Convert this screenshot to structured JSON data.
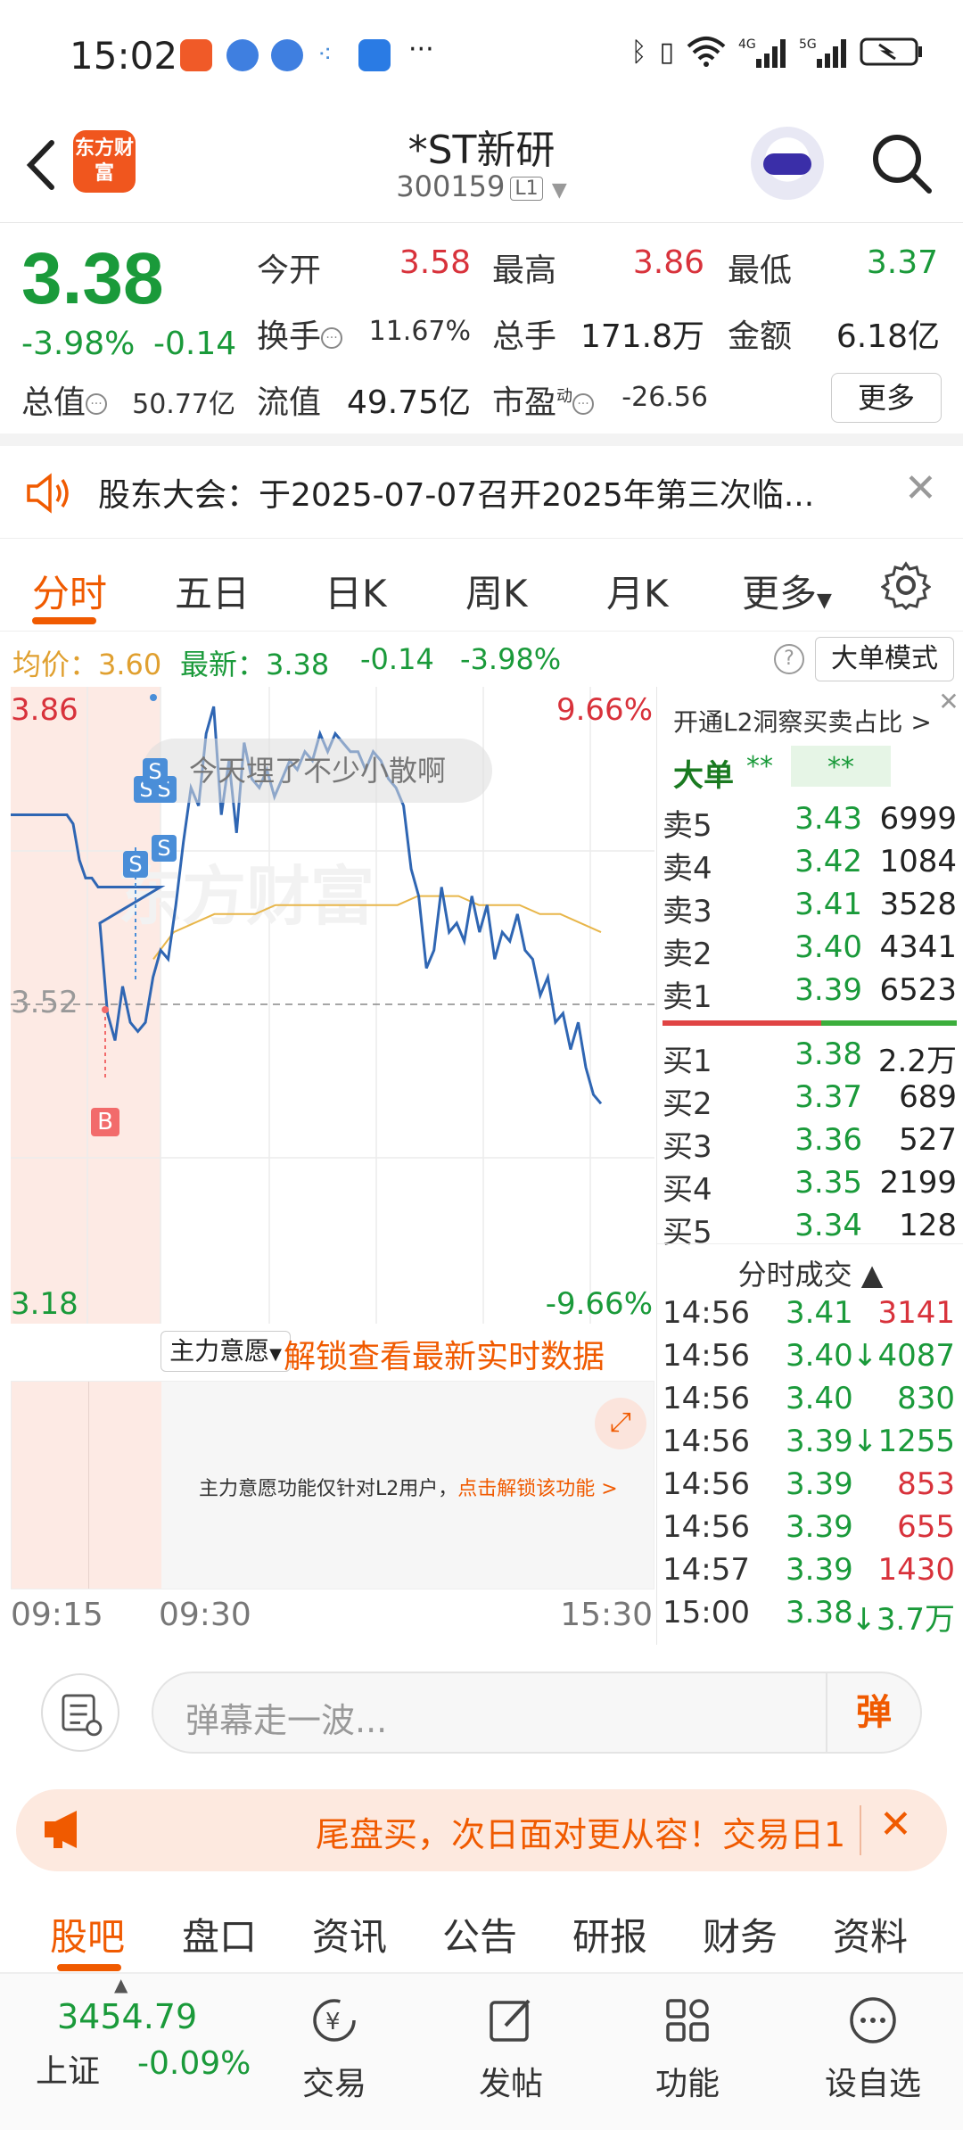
{
  "status_bar": {
    "time": "15:02",
    "more": "···"
  },
  "header": {
    "title": "*ST新研",
    "code": "300159",
    "level": "L1",
    "logo_text": "东方财富"
  },
  "quote": {
    "price": "3.38",
    "change_pct": "-3.98%",
    "change_val": "-0.14",
    "open_label": "今开",
    "open": "3.58",
    "high_label": "最高",
    "high": "3.86",
    "low_label": "最低",
    "low": "3.37",
    "turnover_label": "换手",
    "turnover": "11.67%",
    "volume_label": "总手",
    "volume": "171.8万",
    "amount_label": "金额",
    "amount": "6.18亿",
    "mktcap_label": "总值",
    "mktcap": "50.77亿",
    "float_label": "流值",
    "float": "49.75亿",
    "pe_label": "市盈",
    "pe_sup": "动",
    "pe": "-26.56",
    "more_label": "更多"
  },
  "notice": {
    "text": "股东大会：于2025-07-07召开2025年第三次临..."
  },
  "chart_tabs": {
    "items": [
      "分时",
      "五日",
      "日K",
      "周K",
      "月K",
      "更多"
    ],
    "active": 0
  },
  "info_row": {
    "avg_label": "均价：",
    "avg": "3.60",
    "latest_label": "最新：",
    "latest": "3.38",
    "chg": "-0.14",
    "chg_pct": "-3.98%",
    "help": "?",
    "big_order_mode": "大单模式"
  },
  "chart_data": {
    "type": "line",
    "y_top_label": "3.86",
    "y_mid_label": "3.52",
    "y_bot_label": "3.18",
    "y_top_pct": "9.66%",
    "y_bot_pct": "-9.66%",
    "ylim": [
      3.18,
      3.86
    ],
    "prev_close": 3.52,
    "x_labels": [
      "09:15",
      "09:30",
      "15:30"
    ],
    "danmu": "今天埋了不少小散啊",
    "series": [
      {
        "values": [
          3.73,
          3.73,
          3.73,
          3.73,
          3.73,
          3.73,
          3.73,
          3.73,
          3.73,
          3.73,
          3.72,
          3.68,
          3.66,
          3.66,
          3.65,
          3.65,
          3.65,
          3.65,
          3.65,
          3.65,
          3.65,
          3.65,
          3.65,
          3.65,
          3.65,
          3.61,
          3.51,
          3.48,
          3.54,
          3.5,
          3.49,
          3.5,
          3.55,
          3.58,
          3.57,
          3.63,
          3.7,
          3.76,
          3.74,
          3.82,
          3.85,
          3.73,
          3.79,
          3.71,
          3.81,
          3.77,
          3.76,
          3.78,
          3.75,
          3.77,
          3.79,
          3.78,
          3.8,
          3.79,
          3.82,
          3.8,
          3.82,
          3.81,
          3.8,
          3.8,
          3.78,
          3.8,
          3.79,
          3.77,
          3.76,
          3.74,
          3.67,
          3.64,
          3.56,
          3.58,
          3.65,
          3.6,
          3.61,
          3.59,
          3.64,
          3.6,
          3.63,
          3.57,
          3.6,
          3.59,
          3.62,
          3.58,
          3.57,
          3.53,
          3.55,
          3.5,
          3.51,
          3.47,
          3.5,
          3.45,
          3.42,
          3.41
        ]
      },
      {
        "values": [
          3.57,
          3.6,
          3.61,
          3.62,
          3.62,
          3.62,
          3.63,
          3.63,
          3.63,
          3.63,
          3.63,
          3.63,
          3.63,
          3.64,
          3.64,
          3.64,
          3.63,
          3.63,
          3.63,
          3.62,
          3.62,
          3.61,
          3.6
        ]
      }
    ]
  },
  "indicator": {
    "select_label": "主力意愿",
    "unlock_text": "解锁查看最新实时数据",
    "panel_msg": "主力意愿功能仅针对L2用户，",
    "panel_link": "点击解锁该功能 >"
  },
  "order_book": {
    "l2_text": "开通L2洞察买卖占比 >",
    "big_order": "大单",
    "stars1": "**",
    "stars2": "**",
    "asks": [
      {
        "label": "卖5",
        "price": "3.43",
        "vol": "6999"
      },
      {
        "label": "卖4",
        "price": "3.42",
        "vol": "1084"
      },
      {
        "label": "卖3",
        "price": "3.41",
        "vol": "3528"
      },
      {
        "label": "卖2",
        "price": "3.40",
        "vol": "4341"
      },
      {
        "label": "卖1",
        "price": "3.39",
        "vol": "6523"
      }
    ],
    "bids": [
      {
        "label": "买1",
        "price": "3.38",
        "vol": "2.2万"
      },
      {
        "label": "买2",
        "price": "3.37",
        "vol": "689"
      },
      {
        "label": "买3",
        "price": "3.36",
        "vol": "527"
      },
      {
        "label": "买4",
        "price": "3.35",
        "vol": "2199"
      },
      {
        "label": "买5",
        "price": "3.34",
        "vol": "128"
      }
    ],
    "trades_title": "分时成交 ▲",
    "trades": [
      {
        "time": "14:56",
        "price": "3.41",
        "vol": "3141",
        "color": "#d8323b"
      },
      {
        "time": "14:56",
        "price": "3.40",
        "vol": "↓4087",
        "color": "#1a9a3a"
      },
      {
        "time": "14:56",
        "price": "3.40",
        "vol": "830",
        "color": "#1a9a3a"
      },
      {
        "time": "14:56",
        "price": "3.39",
        "vol": "↓1255",
        "color": "#1a9a3a"
      },
      {
        "time": "14:56",
        "price": "3.39",
        "vol": "853",
        "color": "#d8323b"
      },
      {
        "time": "14:56",
        "price": "3.39",
        "vol": "655",
        "color": "#d8323b"
      },
      {
        "time": "14:57",
        "price": "3.39",
        "vol": "1430",
        "color": "#d8323b"
      },
      {
        "time": "15:00",
        "price": "3.38",
        "vol": "↓3.7万",
        "color": "#1a9a3a"
      }
    ]
  },
  "comment": {
    "placeholder": "弹幕走一波...",
    "danmu_btn": "弹"
  },
  "promo": {
    "text": "尾盘买，次日面对更从容！交易日1"
  },
  "sub_tabs": {
    "items": [
      "股吧",
      "盘口",
      "资讯",
      "公告",
      "研报",
      "财务",
      "资料"
    ],
    "active": 0
  },
  "bottom_nav": {
    "index_value": "3454.79",
    "index_name": "上证",
    "index_chg": "-0.09%",
    "items": [
      "交易",
      "发帖",
      "功能",
      "设自选"
    ]
  },
  "colors": {
    "accent": "#f05a00",
    "up": "#d8323b",
    "down": "#1a9a3a",
    "line": "#2f66b3",
    "avg_line": "#e8b64a"
  }
}
